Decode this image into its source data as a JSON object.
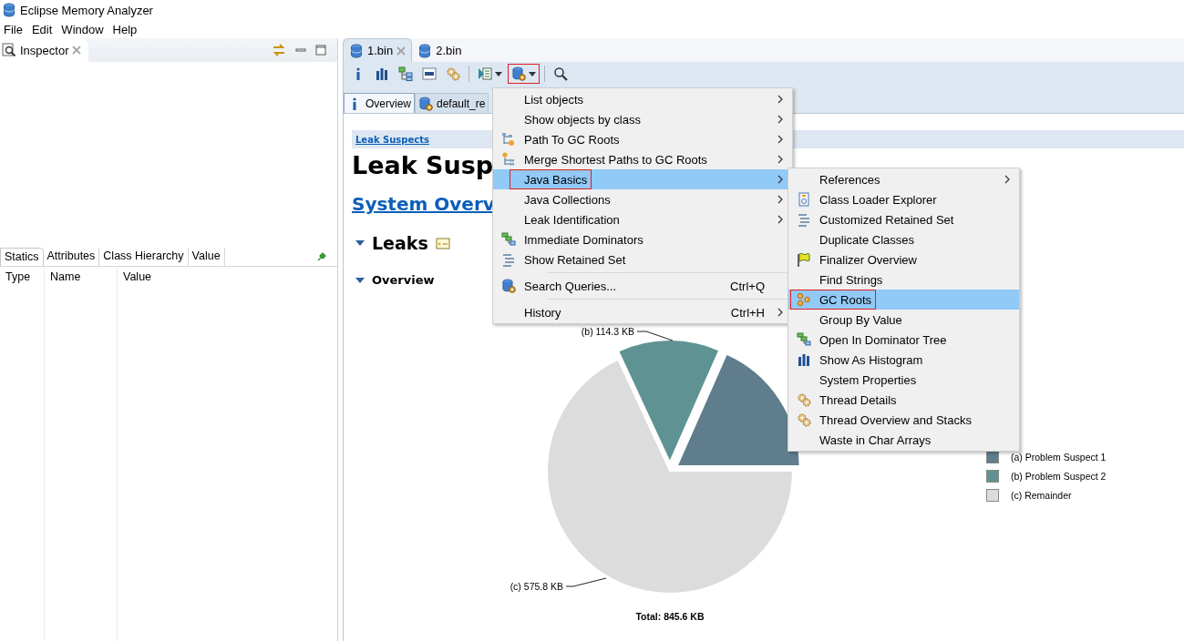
{
  "window": {
    "title": "Eclipse Memory Analyzer"
  },
  "menu_bar": [
    "File",
    "Edit",
    "Window",
    "Help"
  ],
  "inspector": {
    "title": "Inspector",
    "tabs": [
      {
        "label": "Statics",
        "selected": true
      },
      {
        "label": "Attributes",
        "selected": false
      },
      {
        "label": "Class Hierarchy",
        "selected": false
      },
      {
        "label": "Value",
        "selected": false
      }
    ],
    "columns": [
      "Type",
      "Name",
      "Value"
    ]
  },
  "editor_tabs": [
    {
      "label": "1.bin",
      "selected": true
    },
    {
      "label": "2.bin",
      "selected": false
    }
  ],
  "toolbar": [
    {
      "dropdown": false,
      "outlined": false
    },
    {
      "dropdown": false,
      "outlined": false
    },
    {
      "dropdown": false,
      "outlined": false
    },
    {
      "dropdown": false,
      "outlined": false
    },
    {
      "dropdown": false,
      "outlined": false
    },
    {
      "dropdown": true,
      "outlined": false
    },
    {
      "dropdown": true,
      "outlined": true
    },
    {
      "dropdown": false,
      "outlined": false
    }
  ],
  "inner_tabs": [
    {
      "label": "Overview",
      "selected": true
    },
    {
      "label": "default_re",
      "selected": false
    }
  ],
  "report": {
    "breadcrumb": "Leak Suspects",
    "heading": "Leak Susp",
    "link": "System Overv",
    "sections": [
      {
        "label": "Leaks",
        "expanded": true,
        "kind": "section"
      },
      {
        "label": "Overview",
        "expanded": true,
        "kind": "subsection"
      }
    ],
    "chart_data": {
      "type": "pie",
      "values": [
        18.39,
        13.52,
        68.09
      ]
    },
    "slice_labels": [
      {
        "text": "(b)  114.3 KB"
      },
      {
        "text": "(c)  575.8 KB"
      }
    ],
    "total": "Total: 845.6 KB",
    "legend": [
      {
        "text": "(a)  Problem Suspect 1",
        "color": "#5f7d8c"
      },
      {
        "text": "(b)  Problem Suspect 2",
        "color": "#5f9393"
      },
      {
        "text": "(c)  Remainder",
        "color": "#dcdcdc"
      }
    ]
  },
  "query_menu": [
    {
      "kind": "item",
      "label": "List objects",
      "submenu": true,
      "selected": false,
      "outlined": false
    },
    {
      "kind": "item",
      "label": "Show objects by class",
      "submenu": true,
      "selected": false,
      "outlined": false
    },
    {
      "kind": "item",
      "label": "Path To GC Roots",
      "submenu": true,
      "selected": false,
      "outlined": false
    },
    {
      "kind": "item",
      "label": "Merge Shortest Paths to GC Roots",
      "submenu": true,
      "selected": false,
      "outlined": false
    },
    {
      "kind": "item",
      "label": "Java Basics",
      "submenu": true,
      "selected": true,
      "outlined": true
    },
    {
      "kind": "item",
      "label": "Java Collections",
      "submenu": true,
      "selected": false,
      "outlined": false
    },
    {
      "kind": "item",
      "label": "Leak Identification",
      "submenu": true,
      "selected": false,
      "outlined": false
    },
    {
      "kind": "item",
      "label": "Immediate Dominators",
      "submenu": false,
      "selected": false,
      "outlined": false
    },
    {
      "kind": "item",
      "label": "Show Retained Set",
      "submenu": false,
      "selected": false,
      "outlined": false
    },
    {
      "kind": "separator"
    },
    {
      "kind": "item",
      "label": "Search Queries...",
      "shortcut": "Ctrl+Q",
      "submenu": false,
      "selected": false,
      "outlined": false
    },
    {
      "kind": "separator"
    },
    {
      "kind": "item",
      "label": "History",
      "shortcut": "Ctrl+H",
      "submenu": true,
      "selected": false,
      "outlined": false
    }
  ],
  "java_basics_menu": [
    {
      "kind": "item",
      "label": "References",
      "submenu": true,
      "selected": false,
      "outlined": false
    },
    {
      "kind": "item",
      "label": "Class Loader Explorer",
      "submenu": false,
      "selected": false,
      "outlined": false
    },
    {
      "kind": "item",
      "label": "Customized Retained Set",
      "submenu": false,
      "selected": false,
      "outlined": false
    },
    {
      "kind": "item",
      "label": "Duplicate Classes",
      "submenu": false,
      "selected": false,
      "outlined": false
    },
    {
      "kind": "item",
      "label": "Finalizer Overview",
      "submenu": false,
      "selected": false,
      "outlined": false
    },
    {
      "kind": "item",
      "label": "Find Strings",
      "submenu": false,
      "selected": false,
      "outlined": false
    },
    {
      "kind": "item",
      "label": "GC Roots",
      "submenu": false,
      "selected": true,
      "outlined": true
    },
    {
      "kind": "item",
      "label": "Group By Value",
      "submenu": false,
      "selected": false,
      "outlined": false
    },
    {
      "kind": "item",
      "label": "Open In Dominator Tree",
      "submenu": false,
      "selected": false,
      "outlined": false
    },
    {
      "kind": "item",
      "label": "Show As Histogram",
      "submenu": false,
      "selected": false,
      "outlined": false
    },
    {
      "kind": "item",
      "label": "System Properties",
      "submenu": false,
      "selected": false,
      "outlined": false
    },
    {
      "kind": "item",
      "label": "Thread Details",
      "submenu": false,
      "selected": false,
      "outlined": false
    },
    {
      "kind": "item",
      "label": "Thread Overview and Stacks",
      "submenu": false,
      "selected": false,
      "outlined": false
    },
    {
      "kind": "item",
      "label": "Waste in Char Arrays",
      "submenu": false,
      "selected": false,
      "outlined": false
    }
  ]
}
